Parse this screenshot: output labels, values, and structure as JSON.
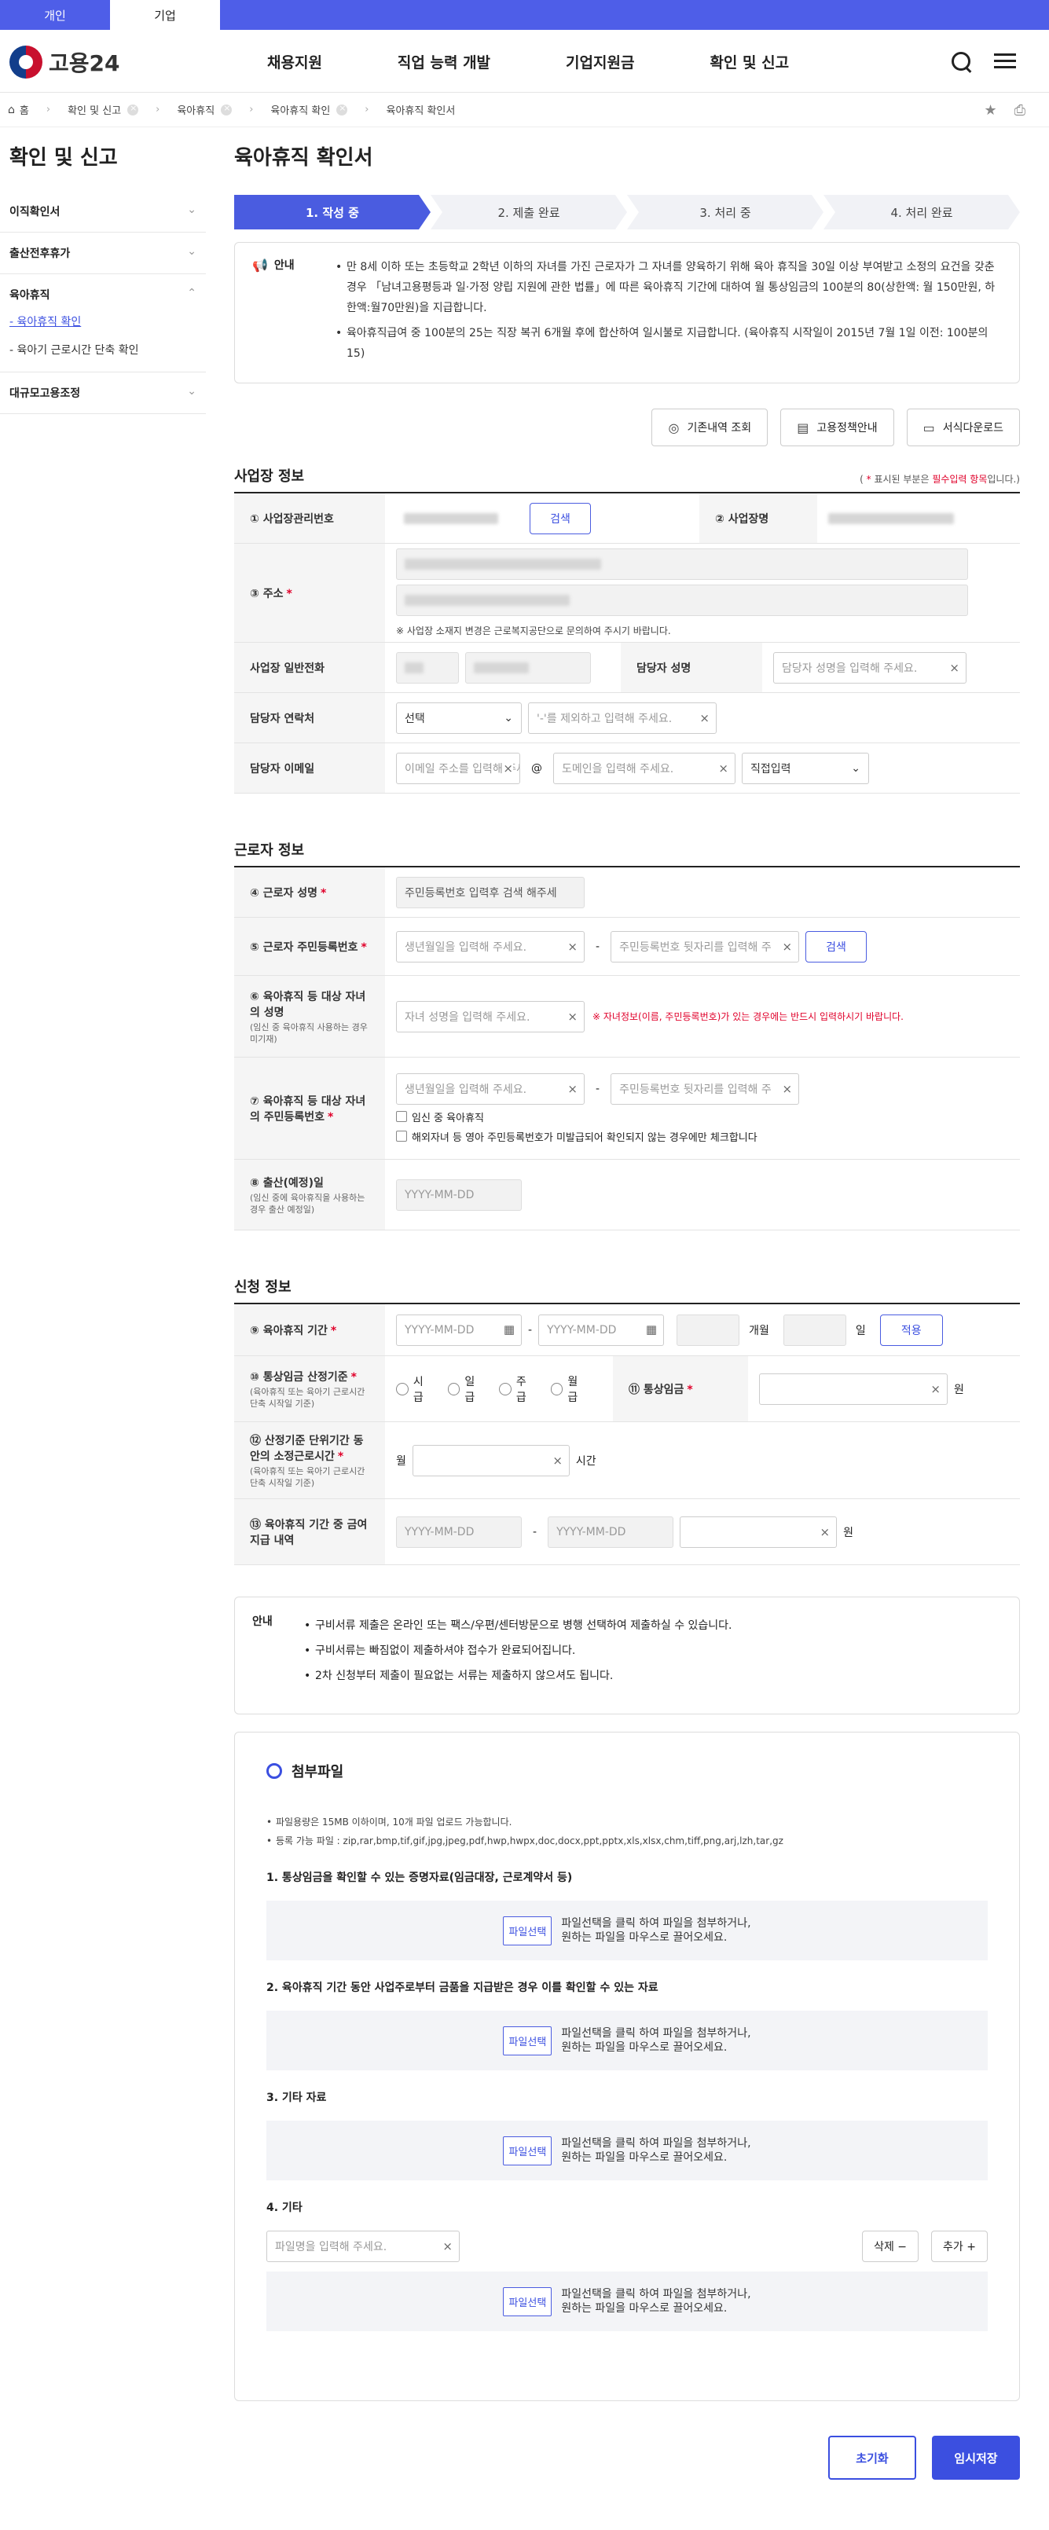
{
  "topbar": {
    "tabs": [
      "개인",
      "기업"
    ],
    "active": 1
  },
  "header": {
    "logo_text": "고용24",
    "nav": [
      "채용지원",
      "직업 능력 개발",
      "기업지원금",
      "확인 및 신고"
    ]
  },
  "breadcrumb": {
    "items": [
      "홈",
      "확인 및 신고",
      "육아휴직",
      "육아휴직 확인",
      "육아휴직 확인서"
    ]
  },
  "sidebar": {
    "title": "확인 및 신고",
    "groups": [
      "이직확인서",
      "출산전후휴가",
      "육아휴직",
      "대규모고용조정"
    ],
    "sub": [
      "- 육아휴직 확인",
      "- 육아기 근로시간 단축 확인"
    ]
  },
  "main": {
    "title": "육아휴직 확인서"
  },
  "steps": [
    "1. 작성 중",
    "2. 제출 완료",
    "3. 처리 중",
    "4. 처리 완료"
  ],
  "notice": {
    "label": "안내",
    "items": [
      "만 8세 이하 또는 초등학교 2학년 이하의 자녀를 가진 근로자가 그 자녀를 양육하기 위해 육아 휴직을 30일 이상 부여받고 소정의 요건을 갖춘 경우 「남녀고용평등과 일·가정 양립 지원에 관한 법률」에 따른 육아휴직 기간에 대하여 월 통상임금의 100분의 80(상한액: 월 150만원, 하한액:월70만원)을 지급합니다.",
      "육아휴직급여 중 100분의 25는 직장 복귀 6개월 후에 합산하여 일시불로 지급합니다. (육아휴직 시작일이 2015년 7월 1일 이전: 100분의15)"
    ]
  },
  "buttons": {
    "history": "기존내역 조회",
    "policy": "고용정책안내",
    "download": "서식다운로드"
  },
  "workplace": {
    "title": "사업장 정보",
    "req_note_pre": "( ",
    "req_note_star": "*",
    "req_note_mid": " 표시된 부분은 ",
    "req_note_red": "필수입력 항목",
    "req_note_post": "입니다.)",
    "mgmt_no": "① 사업장관리번호",
    "search": "검색",
    "name": "② 사업장명",
    "address": "③ 주소",
    "address_note": "※ 사업장 소재지 변경은 근로복지공단으로 문의하여 주시기 바랍니다.",
    "phone": "사업장 일반전화",
    "contact_name": "담당자 성명",
    "contact_name_ph": "담당자 성명을 입력해 주세요.",
    "contact_phone": "담당자 연락처",
    "select": "선택",
    "phone_ph": "'-'를 제외하고 입력해 주세요.",
    "contact_email": "담당자 이메일",
    "email_ph": "이메일 주소를 입력해 주세요.",
    "domain_ph": "도메인을 입력해 주세요.",
    "direct": "직접입력",
    "at": "@"
  },
  "worker": {
    "title": "근로자 정보",
    "name": "④ 근로자 성명",
    "name_ph": "주민등록번호 입력후 검색 해주세",
    "rrn": "⑤ 근로자 주민등록번호",
    "birth_ph": "생년월일을 입력해 주세요.",
    "back_ph": "주민등록번호 뒷자리를 입력해 주",
    "search": "검색",
    "child_name": "⑥ 육아휴직 등 대상 자녀의 성명",
    "child_name_note": "(임신 중 육아휴직 사용하는 경우 미기재)",
    "child_name_ph": "자녀 성명을 입력해 주세요.",
    "child_note": "※ 자녀정보(이름, 주민등록번호)가 있는 경우에는 반드시 입력하시기 바랍니다.",
    "child_rrn": "⑦ 육아휴직 등 대상 자녀의 주민등록번호",
    "chk1": "임신 중 육아휴직",
    "chk2": "해외자녀 등 영아 주민등록번호가 미발급되어 확인되지 않는 경우에만 체크합니다",
    "due": "⑧ 출산(예정)일",
    "due_note": "(임신 중에 육아휴직을 사용하는 경우 출산 예정일)",
    "date_ph": "YYYY-MM-DD",
    "dash": "-"
  },
  "apply": {
    "title": "신청 정보",
    "period": "⑨ 육아휴직 기간",
    "month": "개월",
    "day": "일",
    "apply_btn": "적용",
    "wage_basis": "⑩ 통상임금 산정기준",
    "wage_basis_note": "(육아휴직 또는 육아기 근로시간 단축 시작일 기준)",
    "radios": [
      "시급",
      "일급",
      "주급",
      "월급"
    ],
    "wage": "⑪ 통상임금",
    "won": "원",
    "hours": "⑫ 산정기준 단위기간 동안의 소정근로시간",
    "hours_note": "(육아휴직 또는 육아기 근로시간 단축 시작일 기준)",
    "monthly": "월",
    "hour_unit": "시간",
    "paid": "⑬ 육아휴직 기간 중 금여지급 내역"
  },
  "notice2": {
    "label": "안내",
    "items": [
      "구비서류 제출은 온라인 또는 팩스/우편/센터방문으로 병행 선택하여 제출하실 수 있습니다.",
      "구비서류는 빠짐없이 제출하셔야 접수가 완료되어집니다.",
      "2차 신청부터 제출이 필요없는 서류는 제출하지 않으셔도 됩니다."
    ]
  },
  "attach": {
    "title": "첨부파일",
    "info": [
      "파일용량은 15MB 이하이며, 10개 파일 업로드 가능합니다.",
      "등록 가능 파일 : zip,rar,bmp,tif,gif,jpg,jpeg,pdf,hwp,hwpx,doc,docx,ppt,pptx,xls,xlsx,chm,tiff,png,arj,lzh,tar,gz"
    ],
    "sections": [
      "1. 통상임금을 확인할 수 있는 증명자료(임금대장, 근로계약서 등)",
      "2. 육아휴직 기간 동안 사업주로부터 금품을 지급받은 경우 이를 확인할 수 있는 자료",
      "3. 기타 자료",
      "4. 기타"
    ],
    "file_btn": "파일선택",
    "drop_text1": "파일선택을 클릭 하여 파일을 첨부하거나,",
    "drop_text2": "원하는 파일을 마우스로 끌어오세요.",
    "filename_ph": "파일명을 입력해 주세요.",
    "delete": "삭제 −",
    "add": "추가 +"
  },
  "footer_btns": {
    "reset": "초기화",
    "save": "임시저장"
  }
}
